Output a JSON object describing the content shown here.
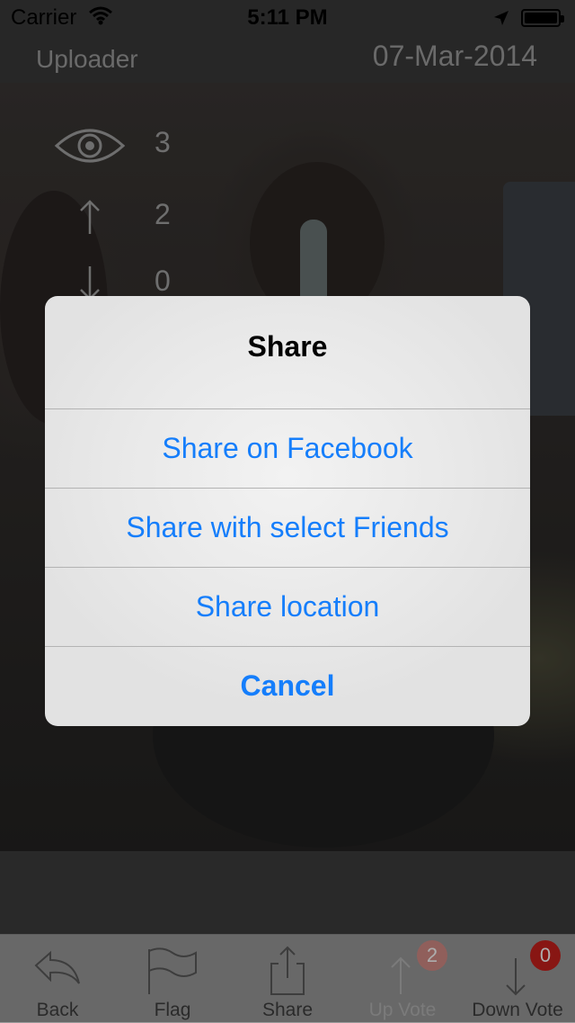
{
  "status_bar": {
    "carrier": "Carrier",
    "time": "5:11 PM"
  },
  "header": {
    "uploader": "Uploader",
    "date": "07-Mar-2014"
  },
  "stats": {
    "views": "3",
    "up_votes": "2",
    "down_votes": "0"
  },
  "alert": {
    "title": "Share",
    "options": [
      {
        "label": "Share on Facebook"
      },
      {
        "label": "Share with select Friends"
      },
      {
        "label": "Share location"
      },
      {
        "label": "Cancel"
      }
    ]
  },
  "tabbar": {
    "items": [
      {
        "label": "Back",
        "icon": "back-arrow-icon"
      },
      {
        "label": "Flag",
        "icon": "flag-icon"
      },
      {
        "label": "Share",
        "icon": "share-icon"
      },
      {
        "label": "Up Vote",
        "icon": "up-arrow-icon",
        "badge": "2"
      },
      {
        "label": "Down Vote",
        "icon": "down-arrow-icon",
        "badge": "0"
      }
    ]
  },
  "colors": {
    "accent": "#157efb",
    "badge_red": "#c9211d"
  }
}
